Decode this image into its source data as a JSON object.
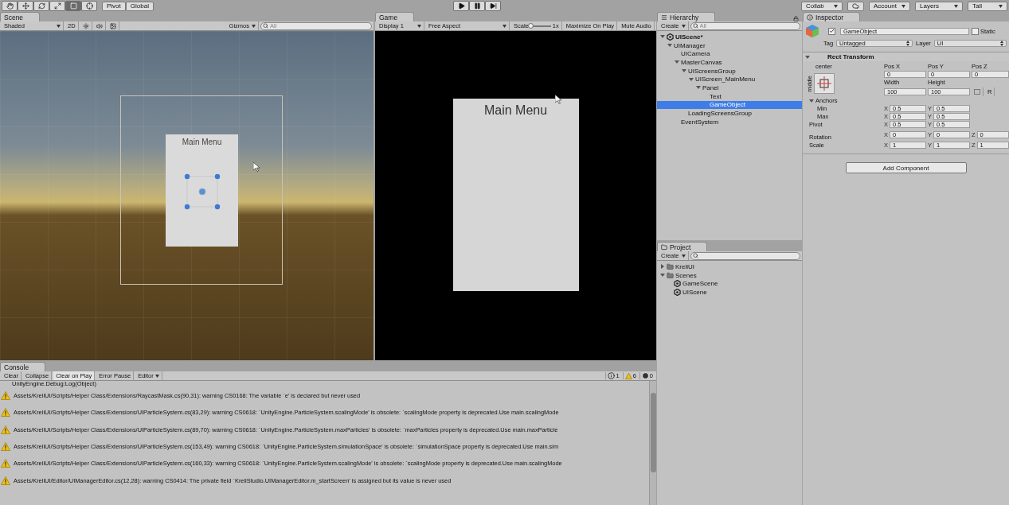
{
  "toolbar": {
    "tools": [
      {
        "kind": "hand",
        "selected": false
      },
      {
        "kind": "move",
        "selected": false
      },
      {
        "kind": "rotate",
        "selected": false
      },
      {
        "kind": "scale",
        "selected": false
      },
      {
        "kind": "rect",
        "selected": true
      },
      {
        "kind": "transform",
        "selected": false
      }
    ],
    "pivot": "Pivot",
    "global": "Global",
    "collab": "Collab",
    "account": "Account",
    "layers": "Layers",
    "layout": "Tall"
  },
  "scene": {
    "tab": "Scene",
    "shading": "Shaded",
    "mode_2d": "2D",
    "gizmos": "Gizmos",
    "search_placeholder": "All",
    "panel_title": "Main Menu"
  },
  "game": {
    "tab": "Game",
    "display": "Display 1",
    "aspect": "Free Aspect",
    "scale_label": "Scale",
    "scale": "1x",
    "level": 0,
    "maximize": "Maximize On Play",
    "mute": "Mute Audio",
    "panel_title": "Main Menu"
  },
  "hierarchy": {
    "tab": "Hierarchy",
    "create": "Create",
    "search_placeholder": "All",
    "tree": [
      {
        "label": "UIScene*",
        "kind": "scene",
        "expanded": true,
        "selected": false,
        "children": [
          {
            "label": "UIManager",
            "expanded": true,
            "selected": false,
            "children": [
              {
                "label": "UICamera",
                "selected": false
              },
              {
                "label": "MasterCanvas",
                "expanded": true,
                "selected": false,
                "children": [
                  {
                    "label": "UIScreensGroup",
                    "expanded": true,
                    "selected": false,
                    "children": [
                      {
                        "label": "UIScreen_MainMenu",
                        "expanded": true,
                        "selected": false,
                        "children": [
                          {
                            "label": "Panel",
                            "expanded": true,
                            "selected": false,
                            "children": [
                              {
                                "label": "Text",
                                "selected": false
                              },
                              {
                                "label": "GameObject",
                                "selected": true
                              }
                            ]
                          }
                        ]
                      }
                    ]
                  },
                  {
                    "label": "LoadingScreensGroup",
                    "selected": false
                  }
                ]
              },
              {
                "label": "EventSystem",
                "selected": false
              }
            ]
          }
        ]
      }
    ]
  },
  "project": {
    "tab": "Project",
    "create": "Create",
    "tree": [
      {
        "label": "KreliUI",
        "kind": "folder",
        "expanded": false
      },
      {
        "label": "Scenes",
        "kind": "folder",
        "expanded": true,
        "children": [
          {
            "label": "GameScene",
            "kind": "scene"
          },
          {
            "label": "UIScene",
            "kind": "scene"
          }
        ]
      }
    ]
  },
  "inspector": {
    "tab": "Inspector",
    "active": true,
    "name": "GameObject",
    "static_label": "Static",
    "static": false,
    "tag_label": "Tag",
    "tag": "Untagged",
    "layer_label": "Layer",
    "layer": "UI",
    "component": {
      "title": "Rect Transform",
      "expanded": true,
      "anchor_h": "center",
      "anchor_v": "middle",
      "pos_labels": [
        "Pos X",
        "Pos Y",
        "Pos Z"
      ],
      "pos_values": [
        "0",
        "0",
        "0"
      ],
      "size_labels": [
        "Width",
        "Height"
      ],
      "size_values": [
        "100",
        "100"
      ],
      "reset": "R",
      "anchors": {
        "label": "Anchors",
        "expanded": true,
        "rows": [
          {
            "label": "Min",
            "fields": [
              {
                "axis": "X",
                "value": "0.5"
              },
              {
                "axis": "Y",
                "value": "0.5"
              }
            ]
          },
          {
            "label": "Max",
            "fields": [
              {
                "axis": "X",
                "value": "0.5"
              },
              {
                "axis": "Y",
                "value": "0.5"
              }
            ]
          }
        ]
      },
      "rows": [
        {
          "label": "Pivot",
          "fields": [
            {
              "axis": "X",
              "value": "0.5"
            },
            {
              "axis": "Y",
              "value": "0.5"
            }
          ]
        },
        {
          "label": "Rotation",
          "fields": [
            {
              "axis": "X",
              "value": "0"
            },
            {
              "axis": "Y",
              "value": "0"
            },
            {
              "axis": "Z",
              "value": "0"
            }
          ]
        },
        {
          "label": "Scale",
          "fields": [
            {
              "axis": "X",
              "value": "1"
            },
            {
              "axis": "Y",
              "value": "1"
            },
            {
              "axis": "Z",
              "value": "1"
            }
          ]
        }
      ]
    },
    "add_component": "Add Component"
  },
  "console": {
    "tab": "Console",
    "buttons": [
      {
        "label": "Clear",
        "kind": "button",
        "selected": false
      },
      {
        "label": "Collapse",
        "kind": "toggle",
        "selected": false
      },
      {
        "label": "Clear on Play",
        "kind": "toggle",
        "selected": true
      },
      {
        "label": "Error Pause",
        "kind": "toggle",
        "selected": false
      },
      {
        "label": "Editor",
        "kind": "dropdown",
        "selected": false
      }
    ],
    "counts": [
      {
        "kind": "info",
        "count": "1"
      },
      {
        "kind": "warning",
        "count": "6"
      },
      {
        "kind": "error",
        "count": "0"
      }
    ],
    "partial_line": "UnityEngine.Debug:Log(Object)",
    "messages": [
      {
        "kind": "warning",
        "text": "Assets/KreliUI/Scripts/Helper Class/Extensions/RaycastMask.cs(90,31): warning CS0168: The variable `e' is declared but never used"
      },
      {
        "kind": "warning",
        "text": "Assets/KreliUI/Scripts/Helper Class/Extensions/UIParticleSystem.cs(83,29): warning CS0618: `UnityEngine.ParticleSystem.scalingMode' is obsolete: `scalingMode property is deprecated.Use main.scalingMode"
      },
      {
        "kind": "warning",
        "text": "Assets/KreliUI/Scripts/Helper Class/Extensions/UIParticleSystem.cs(89,70): warning CS0618: `UnityEngine.ParticleSystem.maxParticles' is obsolete: `maxParticles property is deprecated.Use main.maxParticle"
      },
      {
        "kind": "warning",
        "text": "Assets/KreliUI/Scripts/Helper Class/Extensions/UIParticleSystem.cs(153,49): warning CS0618: `UnityEngine.ParticleSystem.simulationSpace' is obsolete: `simulationSpace property is deprecated.Use main.sim"
      },
      {
        "kind": "warning",
        "text": "Assets/KreliUI/Scripts/Helper Class/Extensions/UIParticleSystem.cs(160,33): warning CS0618: `UnityEngine.ParticleSystem.scalingMode' is obsolete: `scalingMode property is deprecated.Use main.scalingMode"
      },
      {
        "kind": "warning",
        "text": "Assets/KreliUI/Editor/UIManagerEditor.cs(12,28): warning CS0414: The private field `KreliStudio.UIManagerEditor.m_startScreen' is assigned but its value is never used"
      }
    ]
  }
}
